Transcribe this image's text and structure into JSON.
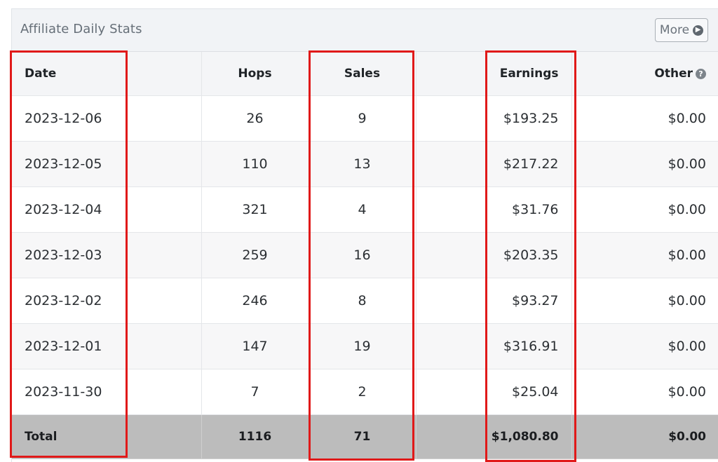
{
  "panel": {
    "title": "Affiliate Daily Stats",
    "more_label": "More",
    "more_icon": "chevron-right-circle-icon"
  },
  "table": {
    "headers": {
      "date": "Date",
      "hops": "Hops",
      "sales": "Sales",
      "earnings": "Earnings",
      "other": "Other",
      "other_help_icon": "question-circle-icon"
    },
    "rows": [
      {
        "date": "2023-12-06",
        "hops": "26",
        "sales": "9",
        "earnings": "$193.25",
        "other": "$0.00"
      },
      {
        "date": "2023-12-05",
        "hops": "110",
        "sales": "13",
        "earnings": "$217.22",
        "other": "$0.00"
      },
      {
        "date": "2023-12-04",
        "hops": "321",
        "sales": "4",
        "earnings": "$31.76",
        "other": "$0.00"
      },
      {
        "date": "2023-12-03",
        "hops": "259",
        "sales": "16",
        "earnings": "$203.35",
        "other": "$0.00"
      },
      {
        "date": "2023-12-02",
        "hops": "246",
        "sales": "8",
        "earnings": "$93.27",
        "other": "$0.00"
      },
      {
        "date": "2023-12-01",
        "hops": "147",
        "sales": "19",
        "earnings": "$316.91",
        "other": "$0.00"
      },
      {
        "date": "2023-11-30",
        "hops": "7",
        "sales": "2",
        "earnings": "$25.04",
        "other": "$0.00"
      }
    ],
    "total": {
      "label": "Total",
      "hops": "1116",
      "sales": "71",
      "earnings": "$1,080.80",
      "other": "$0.00"
    }
  },
  "colors": {
    "highlight_box": "#e01919",
    "header_bg": "#f1f3f6",
    "total_row_bg": "#bcbcbc"
  }
}
